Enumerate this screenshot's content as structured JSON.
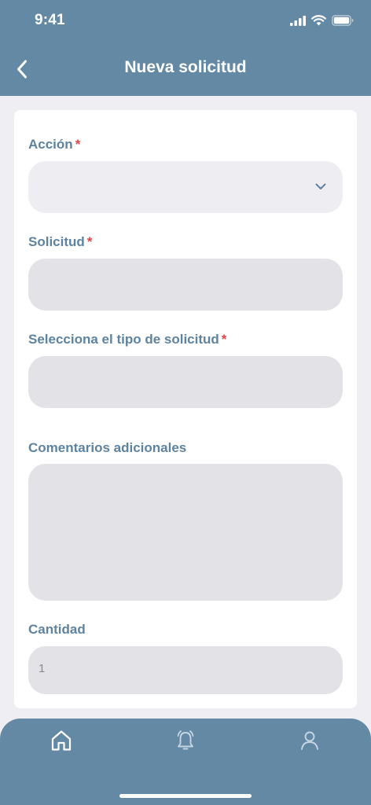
{
  "status_bar": {
    "time": "9:41"
  },
  "header": {
    "title": "Nueva solicitud",
    "back_icon": "chevron-left-icon"
  },
  "form": {
    "accion": {
      "label": "Acción",
      "required_mark": "*",
      "value": ""
    },
    "solicitud": {
      "label": "Solicitud",
      "required_mark": "*",
      "value": ""
    },
    "tipo_solicitud": {
      "label": "Selecciona el tipo de solicitud",
      "required_mark": "*",
      "value": ""
    },
    "comentarios": {
      "label": "Comentarios adicionales",
      "value": ""
    },
    "cantidad": {
      "label": "Cantidad",
      "value": "1"
    }
  },
  "tab_bar": {
    "items": [
      {
        "icon": "home-icon"
      },
      {
        "icon": "bell-alarm-icon"
      },
      {
        "icon": "user-icon"
      }
    ]
  },
  "colors": {
    "primary": "#6489a5",
    "label": "#5d83a0",
    "required": "#e0454a",
    "input_bg": "#e3e2e6",
    "page_bg": "#efeef2"
  }
}
